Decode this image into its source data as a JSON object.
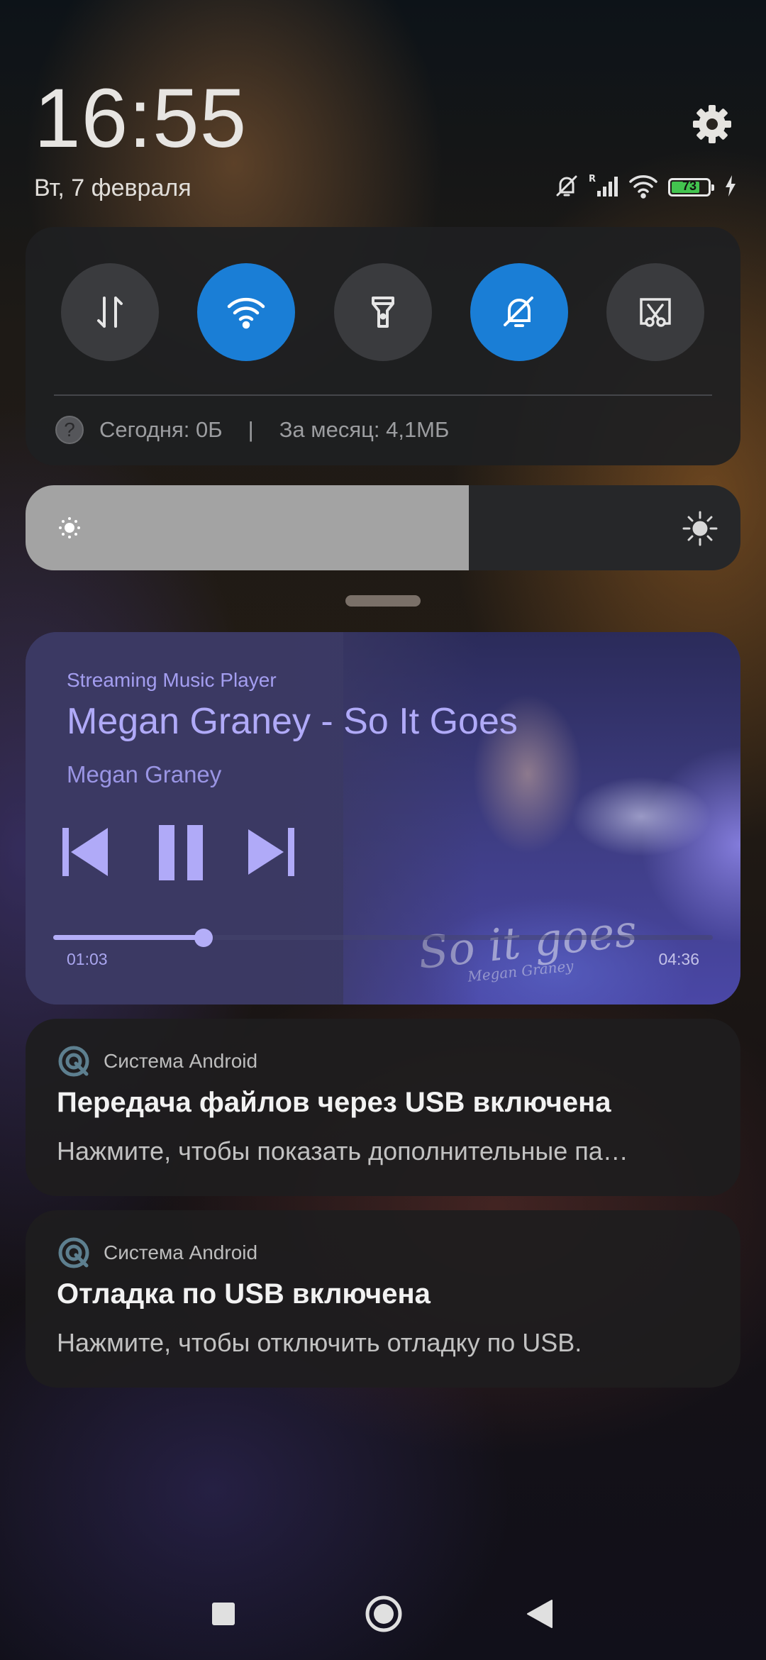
{
  "header": {
    "clock": "16:55",
    "date": "Вт, 7 февраля",
    "battery_level": "73"
  },
  "quick_settings": {
    "toggles": [
      {
        "name": "mobile-data",
        "icon": "data-transfer-icon",
        "active": false
      },
      {
        "name": "wifi",
        "icon": "wifi-icon",
        "active": true
      },
      {
        "name": "flashlight",
        "icon": "flashlight-icon",
        "active": false
      },
      {
        "name": "mute",
        "icon": "bell-off-icon",
        "active": true
      },
      {
        "name": "screenshot",
        "icon": "screenshot-scissors-icon",
        "active": false
      }
    ],
    "data_usage": {
      "today": "Сегодня: 0Б",
      "separator": "|",
      "month": "За месяц: 4,1МБ"
    },
    "active_color": "#1a7ed6"
  },
  "brightness": {
    "level": 0.62
  },
  "media": {
    "app_name": "Streaming Music Player",
    "title": "Megan Graney - So It Goes",
    "artist": "Megan Graney",
    "elapsed": "01:03",
    "duration": "04:36",
    "progress": 0.228,
    "album_art_text": "So it goes",
    "album_art_subtext": "Megan Graney",
    "accent_color": "#b4aef8"
  },
  "notifications": [
    {
      "app": "Система Android",
      "title": "Передача файлов через USB включена",
      "body": "Нажмите, чтобы показать дополнительные па…"
    },
    {
      "app": "Система Android",
      "title": "Отладка по USB включена",
      "body": "Нажмите, чтобы отключить отладку по USB."
    }
  ],
  "navbar": {
    "buttons": [
      "recents-square-icon",
      "home-circle-icon",
      "back-triangle-icon"
    ]
  }
}
